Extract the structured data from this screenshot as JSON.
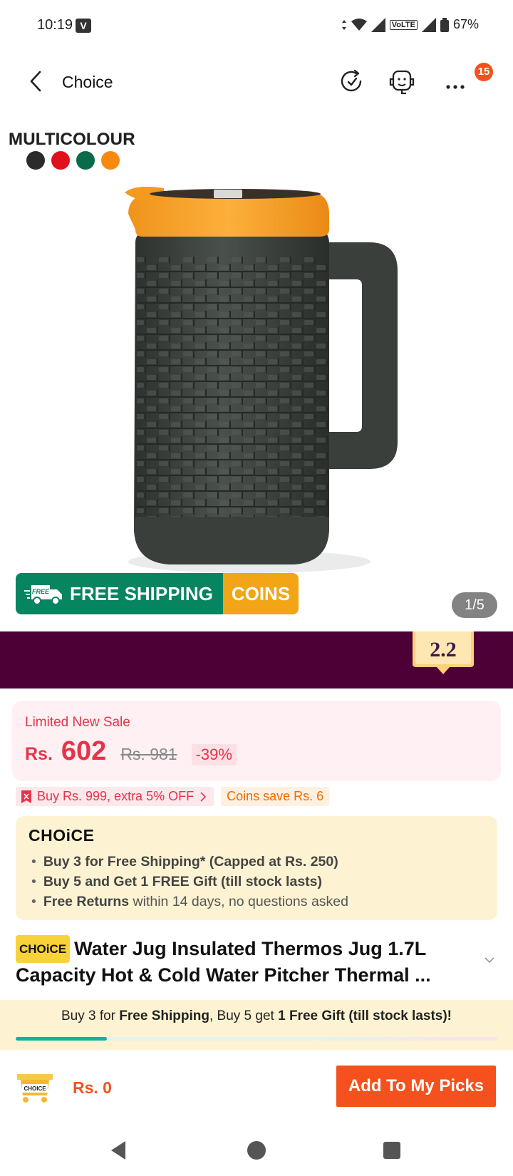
{
  "status_bar": {
    "time": "10:19",
    "carrier_badge": "V",
    "network": "VoLTE",
    "battery": "67%"
  },
  "header": {
    "title": "Choice",
    "notification_count": "15"
  },
  "gallery": {
    "variant_label": "MULTICOLOUR",
    "swatch_colors": [
      "#2b2b2b",
      "#e0101d",
      "#0a6b4a",
      "#f7890f"
    ],
    "shipping_banner": {
      "free_tag": "FREE",
      "shipping_label": "FREE SHIPPING",
      "coins_label": "COINS"
    },
    "counter": "1/5"
  },
  "promo": {
    "tag": "2.2"
  },
  "price": {
    "label": "Limited New Sale",
    "currency": "Rs.",
    "current": "602",
    "original": "Rs. 981",
    "discount": "-39%"
  },
  "coupons": {
    "extra_off": "Buy Rs. 999, extra 5% OFF",
    "coins_save": "Coins save Rs. 6"
  },
  "choice_box": {
    "logo": "CHOiCE",
    "bullets": [
      {
        "bold": "Buy 3 for  Free Shipping* (Capped at Rs. 250)",
        "rest": ""
      },
      {
        "bold": "Buy 5 and Get 1 FREE Gift (till stock lasts)",
        "rest": ""
      },
      {
        "bold": "Free Returns",
        "rest": " within 14 days, no questions asked"
      }
    ]
  },
  "product": {
    "badge": "CHOiCE",
    "title": "Water Jug Insulated Thermos Jug  1.7L Capacity  Hot & Cold Water Pitcher Thermal ..."
  },
  "offer_strip": {
    "part1": "Buy 3 for ",
    "part1_bold": "Free Shipping",
    "part2": ", Buy 5 get ",
    "part2_bold": "1 Free Gift (till stock lasts)!",
    "progress": 0.19
  },
  "bottom": {
    "cart_badge": "CHOICE",
    "cart_price": "Rs. 0",
    "add_button": "Add To My Picks"
  }
}
